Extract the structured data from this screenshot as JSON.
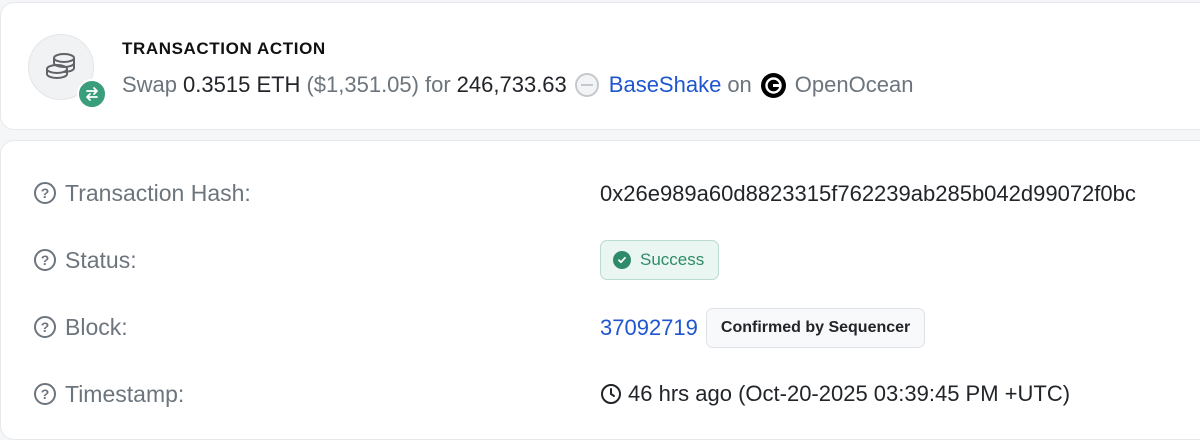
{
  "action": {
    "heading": "TRANSACTION ACTION",
    "verb": "Swap",
    "amount": "0.3515 ETH",
    "usd_value": "($1,351.05)",
    "for_word": "for",
    "token_amount": "246,733.63",
    "token_name": "BaseShake",
    "on_word": "on",
    "dex_name": "OpenOcean",
    "icons": [
      "coins-icon",
      "swap-arrows-icon",
      "token-placeholder-icon",
      "openocean-logo-icon"
    ]
  },
  "details": {
    "hash": {
      "label": "Transaction Hash:",
      "value": "0x26e989a60d8823315f762239ab285b042d99072f0bc"
    },
    "status": {
      "label": "Status:",
      "value": "Success"
    },
    "block": {
      "label": "Block:",
      "number": "37092719",
      "badge": "Confirmed by Sequencer"
    },
    "timestamp": {
      "label": "Timestamp:",
      "value": "46 hrs ago (Oct-20-2025 03:39:45 PM +UTC)"
    }
  },
  "colors": {
    "accent_green": "#3a9d7c",
    "link_blue": "#1f56cf",
    "muted_text": "#6c757d"
  }
}
